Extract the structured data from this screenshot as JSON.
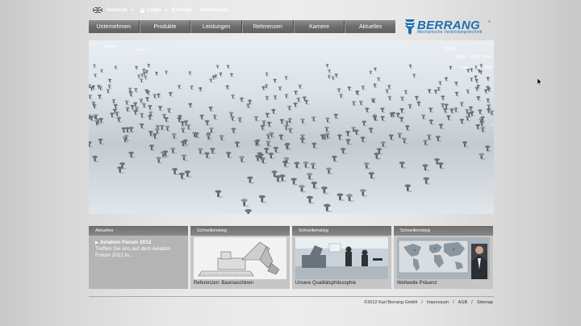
{
  "topbar": {
    "language": "Deutsch",
    "login": "Login",
    "contact": "Kontakt",
    "downloads": "Downloads"
  },
  "nav": {
    "items": [
      "Unternehmen",
      "Produkte",
      "Leistungen",
      "Referenzen",
      "Karriere",
      "Aktuelles"
    ]
  },
  "logo": {
    "name": "BERRANG",
    "registered": "®",
    "tagline": "Mechanische Verbindungstechnik"
  },
  "news": {
    "heading": "Aktuelles",
    "title": "Aviation Forum 2012",
    "text": "Treffen Sie uns auf dem Aviation Forum 2012 in..."
  },
  "quicklinks": [
    {
      "heading": "Schnelleinstieg",
      "caption": "Referenzen: Baumaschinen"
    },
    {
      "heading": "Schnelleinstieg",
      "caption": "Unsere Qualitätsphilosophie"
    },
    {
      "heading": "Schnelleinstieg",
      "caption": "Weltweite Präsenz"
    }
  ],
  "footer": {
    "copyright": "©2012 Karl Berrang GmbH",
    "imprint": "Impressum",
    "terms": "AGB",
    "sitemap": "Sitemap"
  },
  "colors": {
    "brand": "#1a6fb4",
    "nav": "#6d6d6d",
    "panel": "#b4b4b4"
  }
}
